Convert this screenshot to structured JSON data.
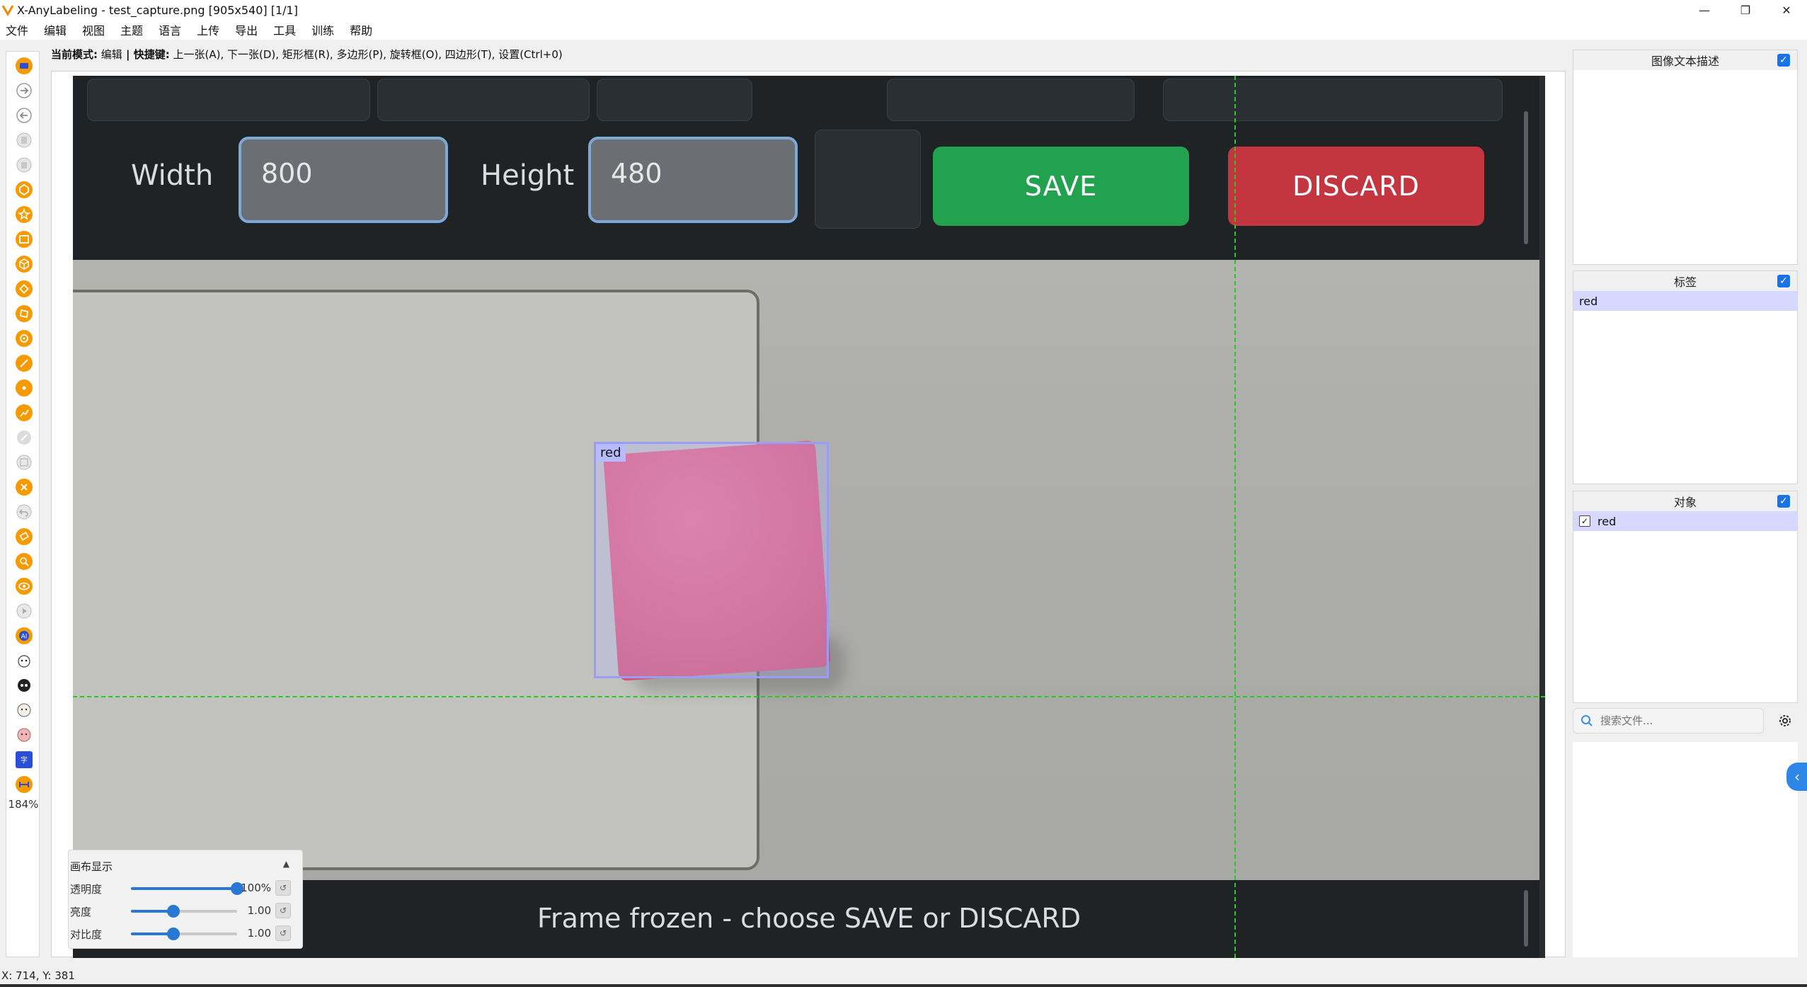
{
  "window": {
    "title": "X-AnyLabeling - test_capture.png [905x540] [1/1]",
    "minimize": "—",
    "maximize": "❐",
    "close": "✕"
  },
  "menu": [
    "文件",
    "编辑",
    "视图",
    "主题",
    "语言",
    "上传",
    "导出",
    "工具",
    "训练",
    "帮助"
  ],
  "modebar": {
    "mode_label": "当前模式:",
    "mode_value": "编辑",
    "sep": " | ",
    "shortcut_label": "快捷键:",
    "shortcuts": "上一张(A), 下一张(D), 矩形框(R), 多边形(P), 旋转框(O), 四边形(T), 设置(Ctrl+0)"
  },
  "toolbar": {
    "zoom": "184%"
  },
  "canvas_image": {
    "width_label": "Width",
    "width_value": "800",
    "height_label": "Height",
    "height_value": "480",
    "save_label": "SAVE",
    "discard_label": "DISCARD",
    "frozen_text": "Frame frozen - choose SAVE or DISCARD",
    "annotation_label": "red"
  },
  "canvas_panel": {
    "title": "画布显示",
    "collapse": "▲",
    "opacity_label": "透明度",
    "opacity_value": "100%",
    "opacity_level": 1.0,
    "brightness_label": "亮度",
    "brightness_value": "1.00",
    "brightness_level": 0.4,
    "contrast_label": "对比度",
    "contrast_value": "1.00",
    "contrast_level": 0.4,
    "reset": "↺"
  },
  "right_panels": {
    "description_title": "图像文本描述",
    "labels_title": "标签",
    "labels": [
      "red"
    ],
    "objects_title": "对象",
    "objects": [
      "red"
    ],
    "check": "✓"
  },
  "search": {
    "placeholder": "搜索文件..."
  },
  "status": {
    "coords": "X: 714, Y: 381"
  },
  "colors": {
    "accent": "#1a73e8",
    "tool_orange": "#f59a00",
    "save_green": "#22a24f",
    "discard_red": "#c4363f",
    "bbox": "#9a9cf5",
    "guide": "#22cc22"
  }
}
